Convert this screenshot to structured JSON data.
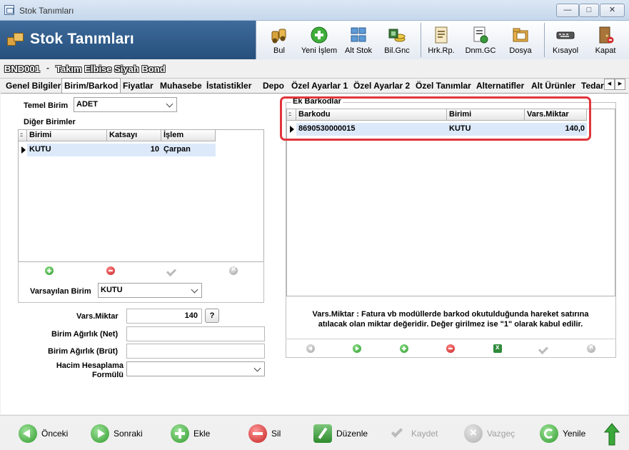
{
  "window": {
    "title": "Stok Tanımları"
  },
  "header": {
    "title": "Stok Tanımları"
  },
  "toolbar": {
    "buttons": [
      {
        "label": "Bul",
        "icon": "search-binoculars-icon"
      },
      {
        "label": "Yeni İşlem",
        "icon": "new-record-plus-icon"
      },
      {
        "label": "Alt Stok",
        "icon": "sub-stock-icon"
      },
      {
        "label": "Bil.Gnc",
        "icon": "update-coins-icon"
      },
      {
        "label": "Hrk.Rp.",
        "icon": "movement-report-icon"
      },
      {
        "label": "Dnm.GC",
        "icon": "period-document-icon"
      },
      {
        "label": "Dosya",
        "icon": "file-folder-icon"
      },
      {
        "label": "Kısayol",
        "icon": "keyboard-shortcut-icon"
      },
      {
        "label": "Kapat",
        "icon": "exit-door-icon"
      }
    ]
  },
  "record": {
    "code": "BND001",
    "separator": "-",
    "name": "Takım Elbise Siyah Bond"
  },
  "tabs": [
    "Genel Bilgiler",
    "Birim/Barkod",
    "Fiyatlar",
    "Muhasebe",
    "İstatistikler",
    "Depo",
    "Özel Ayarlar 1",
    "Özel Ayarlar 2",
    "Özel Tanımlar",
    "Alternatifler",
    "Alt Ürünler",
    "Tedar"
  ],
  "active_tab": "Birim/Barkod",
  "left": {
    "temel_birim_label": "Temel Birim",
    "temel_birim_value": "ADET",
    "diger_birimler_title": "Diğer Birimler",
    "columns": [
      "Birimi",
      "Katsayı",
      "İşlem"
    ],
    "rows": [
      {
        "birimi": "KUTU",
        "katsayi": "10",
        "islem": "Çarpan"
      }
    ],
    "varsayilan_birim_label": "Varsayılan Birim",
    "varsayilan_birim_value": "KUTU",
    "vars_miktar_label": "Vars.Miktar",
    "vars_miktar_value": "140",
    "help_label": "?",
    "birim_agirlik_net_label": "Birim Ağırlık (Net)",
    "birim_agirlik_net_value": "",
    "birim_agirlik_brut_label": "Birim Ağırlık (Brüt)",
    "birim_agirlik_brut_value": "",
    "hacim_label_1": "Hacim Hesaplama",
    "hacim_label_2": "Formülü",
    "hacim_value": ""
  },
  "right": {
    "title": "Ek Barkodlar",
    "columns": [
      "Barkodu",
      "Birimi",
      "Vars.Miktar"
    ],
    "rows": [
      {
        "barkodu": "8690530000015",
        "birimi": "KUTU",
        "vars_miktar": "140,0"
      }
    ],
    "hint_line1": "Vars.Miktar : Fatura vb modüllerde barkod okutulduğunda hareket satırına",
    "hint_line2": "atılacak olan miktar değeridir. Değer girilmez ise \"1\" olarak kabul edilir."
  },
  "highlight_color": "#e0353b",
  "bottom": {
    "buttons": [
      {
        "label": "Önceki",
        "enabled": true
      },
      {
        "label": "Sonraki",
        "enabled": true
      },
      {
        "label": "Ekle",
        "enabled": true
      },
      {
        "label": "Sil",
        "enabled": true
      },
      {
        "label": "Düzenle",
        "enabled": true
      },
      {
        "label": "Kaydet",
        "enabled": false
      },
      {
        "label": "Vazgeç",
        "enabled": false
      },
      {
        "label": "Yenile",
        "enabled": true
      }
    ]
  }
}
